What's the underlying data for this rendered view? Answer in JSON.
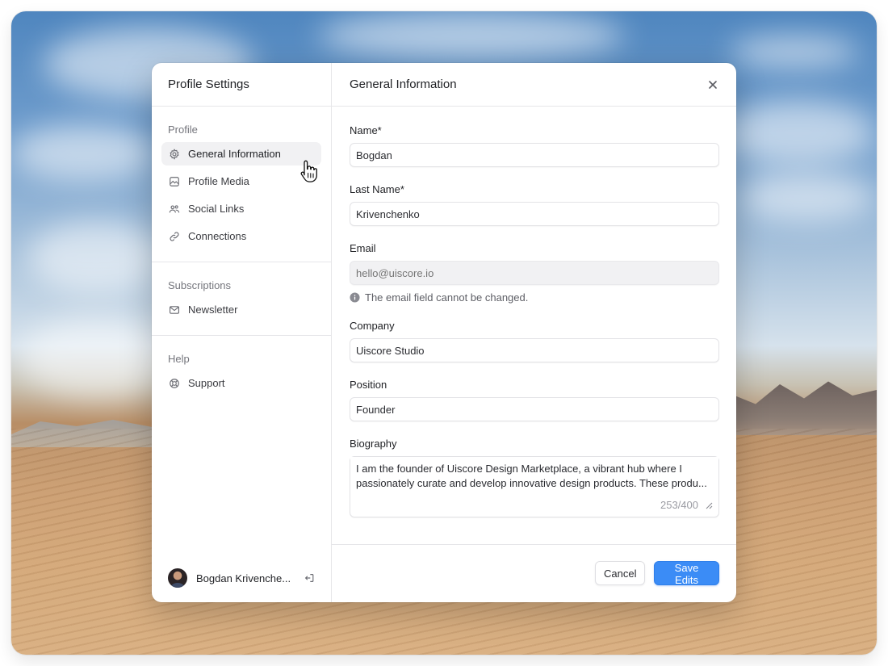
{
  "sidebar": {
    "title": "Profile Settings",
    "sections": [
      {
        "title": "Profile",
        "items": [
          {
            "label": "General Information",
            "icon": "gear-icon",
            "active": true
          },
          {
            "label": "Profile Media",
            "icon": "image-icon"
          },
          {
            "label": "Social Links",
            "icon": "users-icon"
          },
          {
            "label": "Connections",
            "icon": "link-icon"
          }
        ]
      },
      {
        "title": "Subscriptions",
        "items": [
          {
            "label": "Newsletter",
            "icon": "mail-icon"
          }
        ]
      },
      {
        "title": "Help",
        "items": [
          {
            "label": "Support",
            "icon": "lifebuoy-icon"
          }
        ]
      }
    ],
    "user": {
      "name": "Bogdan Krivenche..."
    }
  },
  "main": {
    "title": "General Information",
    "fields": {
      "name": {
        "label": "Name*",
        "value": "Bogdan"
      },
      "last_name": {
        "label": "Last Name*",
        "value": "Krivenchenko"
      },
      "email": {
        "label": "Email",
        "placeholder": "hello@uiscore.io",
        "hint": "The email field cannot be changed."
      },
      "company": {
        "label": "Company",
        "value": "Uiscore Studio"
      },
      "position": {
        "label": "Position",
        "value": "Founder"
      },
      "biography": {
        "label": "Biography",
        "value": "I am the founder of Uiscore Design Marketplace, a vibrant hub where I\npassionately curate and develop innovative design products. These produ...",
        "counter": "253/400"
      }
    },
    "buttons": {
      "cancel": "Cancel",
      "save": "Save Edits"
    }
  },
  "colors": {
    "accent": "#3b8cf6",
    "active_item_bg": "#f1f1f3",
    "disabled_bg": "#f1f1f3"
  }
}
